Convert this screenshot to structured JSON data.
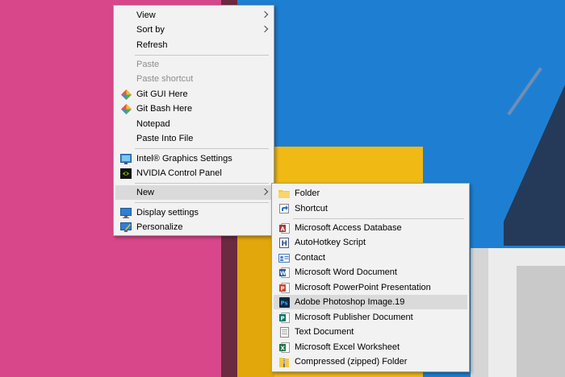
{
  "context_menu": {
    "items": [
      {
        "label": "View"
      },
      {
        "label": "Sort by"
      },
      {
        "label": "Refresh"
      },
      {
        "label": "Paste"
      },
      {
        "label": "Paste shortcut"
      },
      {
        "label": "Git GUI Here"
      },
      {
        "label": "Git Bash Here"
      },
      {
        "label": "Notepad"
      },
      {
        "label": "Paste Into File"
      },
      {
        "label": "Intel® Graphics Settings"
      },
      {
        "label": "NVIDIA Control Panel"
      },
      {
        "label": "New"
      },
      {
        "label": "Display settings"
      },
      {
        "label": "Personalize"
      }
    ]
  },
  "new_submenu": {
    "items": [
      {
        "label": "Folder"
      },
      {
        "label": "Shortcut"
      },
      {
        "label": "Microsoft Access Database"
      },
      {
        "label": "AutoHotkey Script"
      },
      {
        "label": "Contact"
      },
      {
        "label": "Microsoft Word Document"
      },
      {
        "label": "Microsoft PowerPoint Presentation"
      },
      {
        "label": "Adobe Photoshop Image.19"
      },
      {
        "label": "Microsoft Publisher Document"
      },
      {
        "label": "Text Document"
      },
      {
        "label": "Microsoft Excel Worksheet"
      },
      {
        "label": "Compressed (zipped) Folder"
      }
    ]
  },
  "colors": {
    "menu_bg": "#f2f2f2",
    "highlight": "#dadada",
    "disabled_text": "#8d8d8d"
  }
}
